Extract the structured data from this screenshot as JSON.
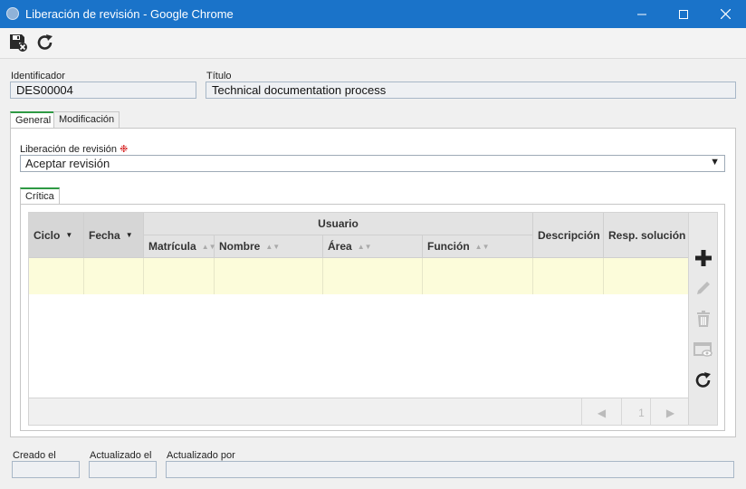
{
  "window": {
    "title": "Liberación de revisión - Google Chrome"
  },
  "form": {
    "identificador_label": "Identificador",
    "identificador_value": "DES00004",
    "titulo_label": "Título",
    "titulo_value": "Technical documentation process"
  },
  "tabs": [
    {
      "label": "General"
    },
    {
      "label": "Modificación"
    }
  ],
  "general": {
    "liberacion_label": "Liberación de revisión",
    "required_mark": "❉",
    "liberacion_value": "Aceptar revisión",
    "subtab": "Crítica"
  },
  "grid": {
    "col_ciclo": "Ciclo",
    "col_fecha": "Fecha",
    "group_usuario": "Usuario",
    "col_matricula": "Matrícula",
    "col_nombre": "Nombre",
    "col_area": "Área",
    "col_funcion": "Función",
    "col_descripcion": "Descripción",
    "col_resp": "Resp. solución",
    "page": "1"
  },
  "footer": {
    "creado_label": "Creado el",
    "actualizado_label": "Actualizado el",
    "actualizado_por_label": "Actualizado por"
  },
  "icons": {
    "save": "save-close-icon",
    "reload": "reload-icon",
    "add": "plus-icon",
    "edit": "pencil-icon",
    "delete": "trash-icon",
    "view": "view-icon",
    "refresh": "refresh-icon"
  },
  "colors": {
    "titlebar": "#1a73c9",
    "tab_accent": "#2e9a44",
    "row_highlight": "#fcfcda"
  }
}
